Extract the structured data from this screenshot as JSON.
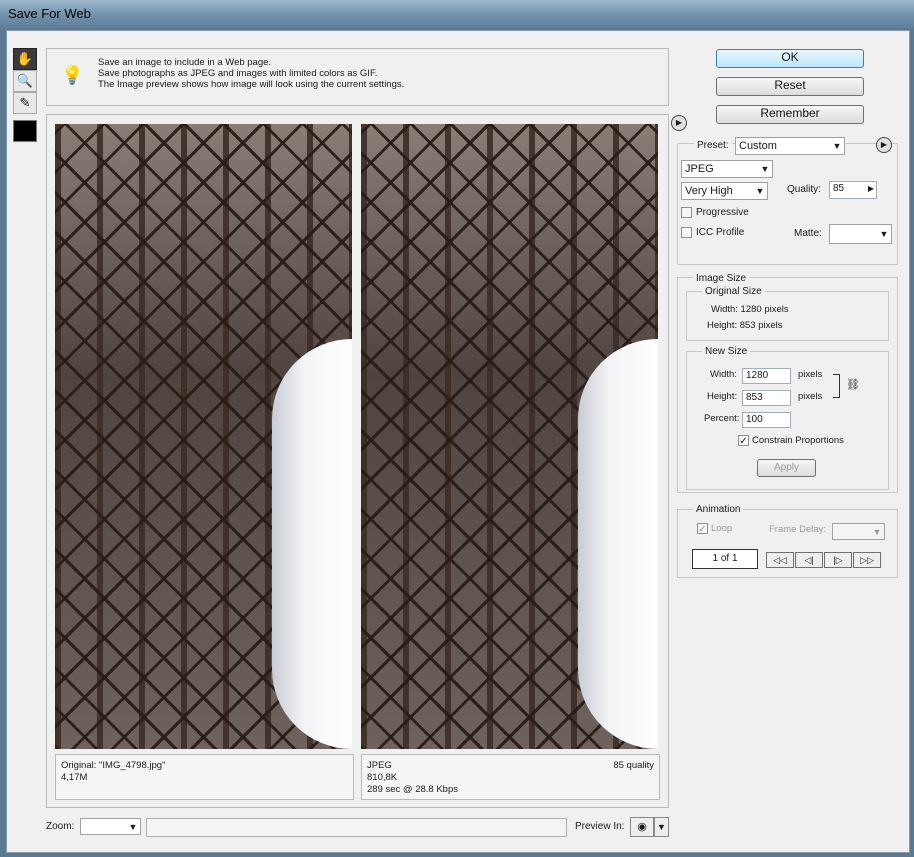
{
  "window": {
    "title": "Save For Web"
  },
  "tools": {
    "hand": "hand-icon",
    "zoom": "zoom-icon",
    "eyedropper": "eyedropper-icon",
    "swatch": "color-swatch"
  },
  "tip": {
    "line1": "Save an image to include in a Web page.",
    "line2": "Save photographs as JPEG and images with limited colors as GIF.",
    "line3": "The Image preview shows how image will look using the current settings."
  },
  "buttons": {
    "ok": "OK",
    "reset": "Reset",
    "remember": "Remember"
  },
  "settings": {
    "preset_label": "Preset:",
    "preset_value": "Custom",
    "format": "JPEG",
    "quality_preset": "Very High",
    "quality_label": "Quality:",
    "quality_value": "85",
    "progressive_label": "Progressive",
    "progressive_checked": false,
    "icc_label": "ICC Profile",
    "icc_checked": false,
    "matte_label": "Matte:"
  },
  "image_size": {
    "group_label": "Image Size",
    "original": {
      "label": "Original Size",
      "width_text": "Width:  1280 pixels",
      "height_text": "Height:  853 pixels"
    },
    "new": {
      "label": "New Size",
      "width_label": "Width:",
      "width_value": "1280",
      "height_label": "Height:",
      "height_value": "853",
      "unit": "pixels",
      "percent_label": "Percent:",
      "percent_value": "100",
      "constrain_label": "Constrain Proportions",
      "constrain_checked": true,
      "apply": "Apply"
    }
  },
  "animation": {
    "group_label": "Animation",
    "loop_label": "Loop",
    "loop_checked": true,
    "frame_delay_label": "Frame Delay:",
    "frame_counter": "1 of 1",
    "nav": {
      "first": "◁◁",
      "prev": "◁|",
      "next": "|▷",
      "last": "▷▷"
    }
  },
  "previews": {
    "left": {
      "line1": "Original: \"IMG_4798.jpg\"",
      "line2": "4,17M"
    },
    "right": {
      "format": "JPEG",
      "quality": "85 quality",
      "size": "810,8K",
      "time": "289 sec @ 28.8 Kbps"
    }
  },
  "footer": {
    "zoom_label": "Zoom:",
    "preview_in_label": "Preview In:"
  }
}
